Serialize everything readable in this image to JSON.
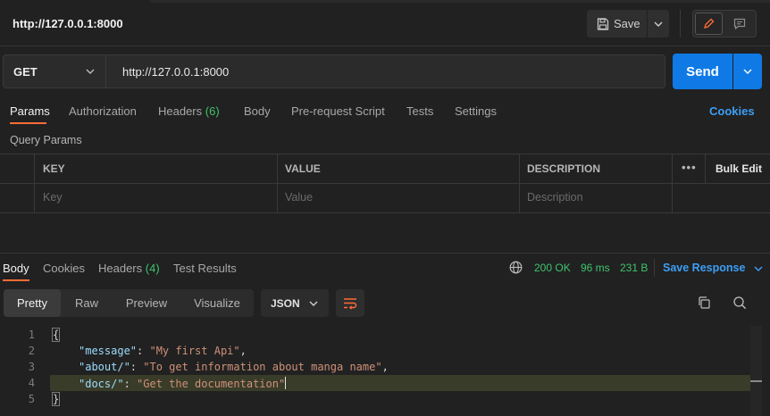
{
  "request": {
    "title": "http://127.0.0.1:8000",
    "save_label": "Save",
    "method": "GET",
    "url": "http://127.0.0.1:8000",
    "send_label": "Send"
  },
  "request_tabs": [
    {
      "label": "Params",
      "active": true
    },
    {
      "label": "Authorization"
    },
    {
      "label": "Headers",
      "count": "(6)"
    },
    {
      "label": "Body"
    },
    {
      "label": "Pre-request Script"
    },
    {
      "label": "Tests"
    },
    {
      "label": "Settings"
    }
  ],
  "cookies_label": "Cookies",
  "query_params": {
    "section_label": "Query Params",
    "headers": [
      "KEY",
      "VALUE",
      "DESCRIPTION"
    ],
    "bulk_edit": "Bulk Edit",
    "more": "•••",
    "placeholders": [
      "Key",
      "Value",
      "Description"
    ]
  },
  "response": {
    "tabs": [
      {
        "label": "Body",
        "active": true
      },
      {
        "label": "Cookies"
      },
      {
        "label": "Headers",
        "count": "(4)"
      },
      {
        "label": "Test Results"
      }
    ],
    "status": "200 OK",
    "time": "96 ms",
    "size": "231 B",
    "save_response": "Save Response",
    "views": [
      "Pretty",
      "Raw",
      "Preview",
      "Visualize"
    ],
    "active_view": "Pretty",
    "format": "JSON",
    "lines": [
      {
        "no": "1"
      },
      {
        "no": "2",
        "key": "\"message\"",
        "value": "\"My first Api\"",
        "comma": ","
      },
      {
        "no": "3",
        "key": "\"about/\"",
        "value": "\"To get information about manga name\"",
        "comma": ","
      },
      {
        "no": "4",
        "key": "\"docs/\"",
        "value": "\"Get the documentation\"",
        "comma": ""
      },
      {
        "no": "5"
      }
    ],
    "open_brace": "{",
    "close_brace": "}",
    "colon": ": "
  },
  "colors": {
    "accent_orange": "#ff6c37",
    "primary_blue": "#0f7ae5",
    "success_green": "#3ec46d",
    "link_blue": "#3d9ef5"
  }
}
